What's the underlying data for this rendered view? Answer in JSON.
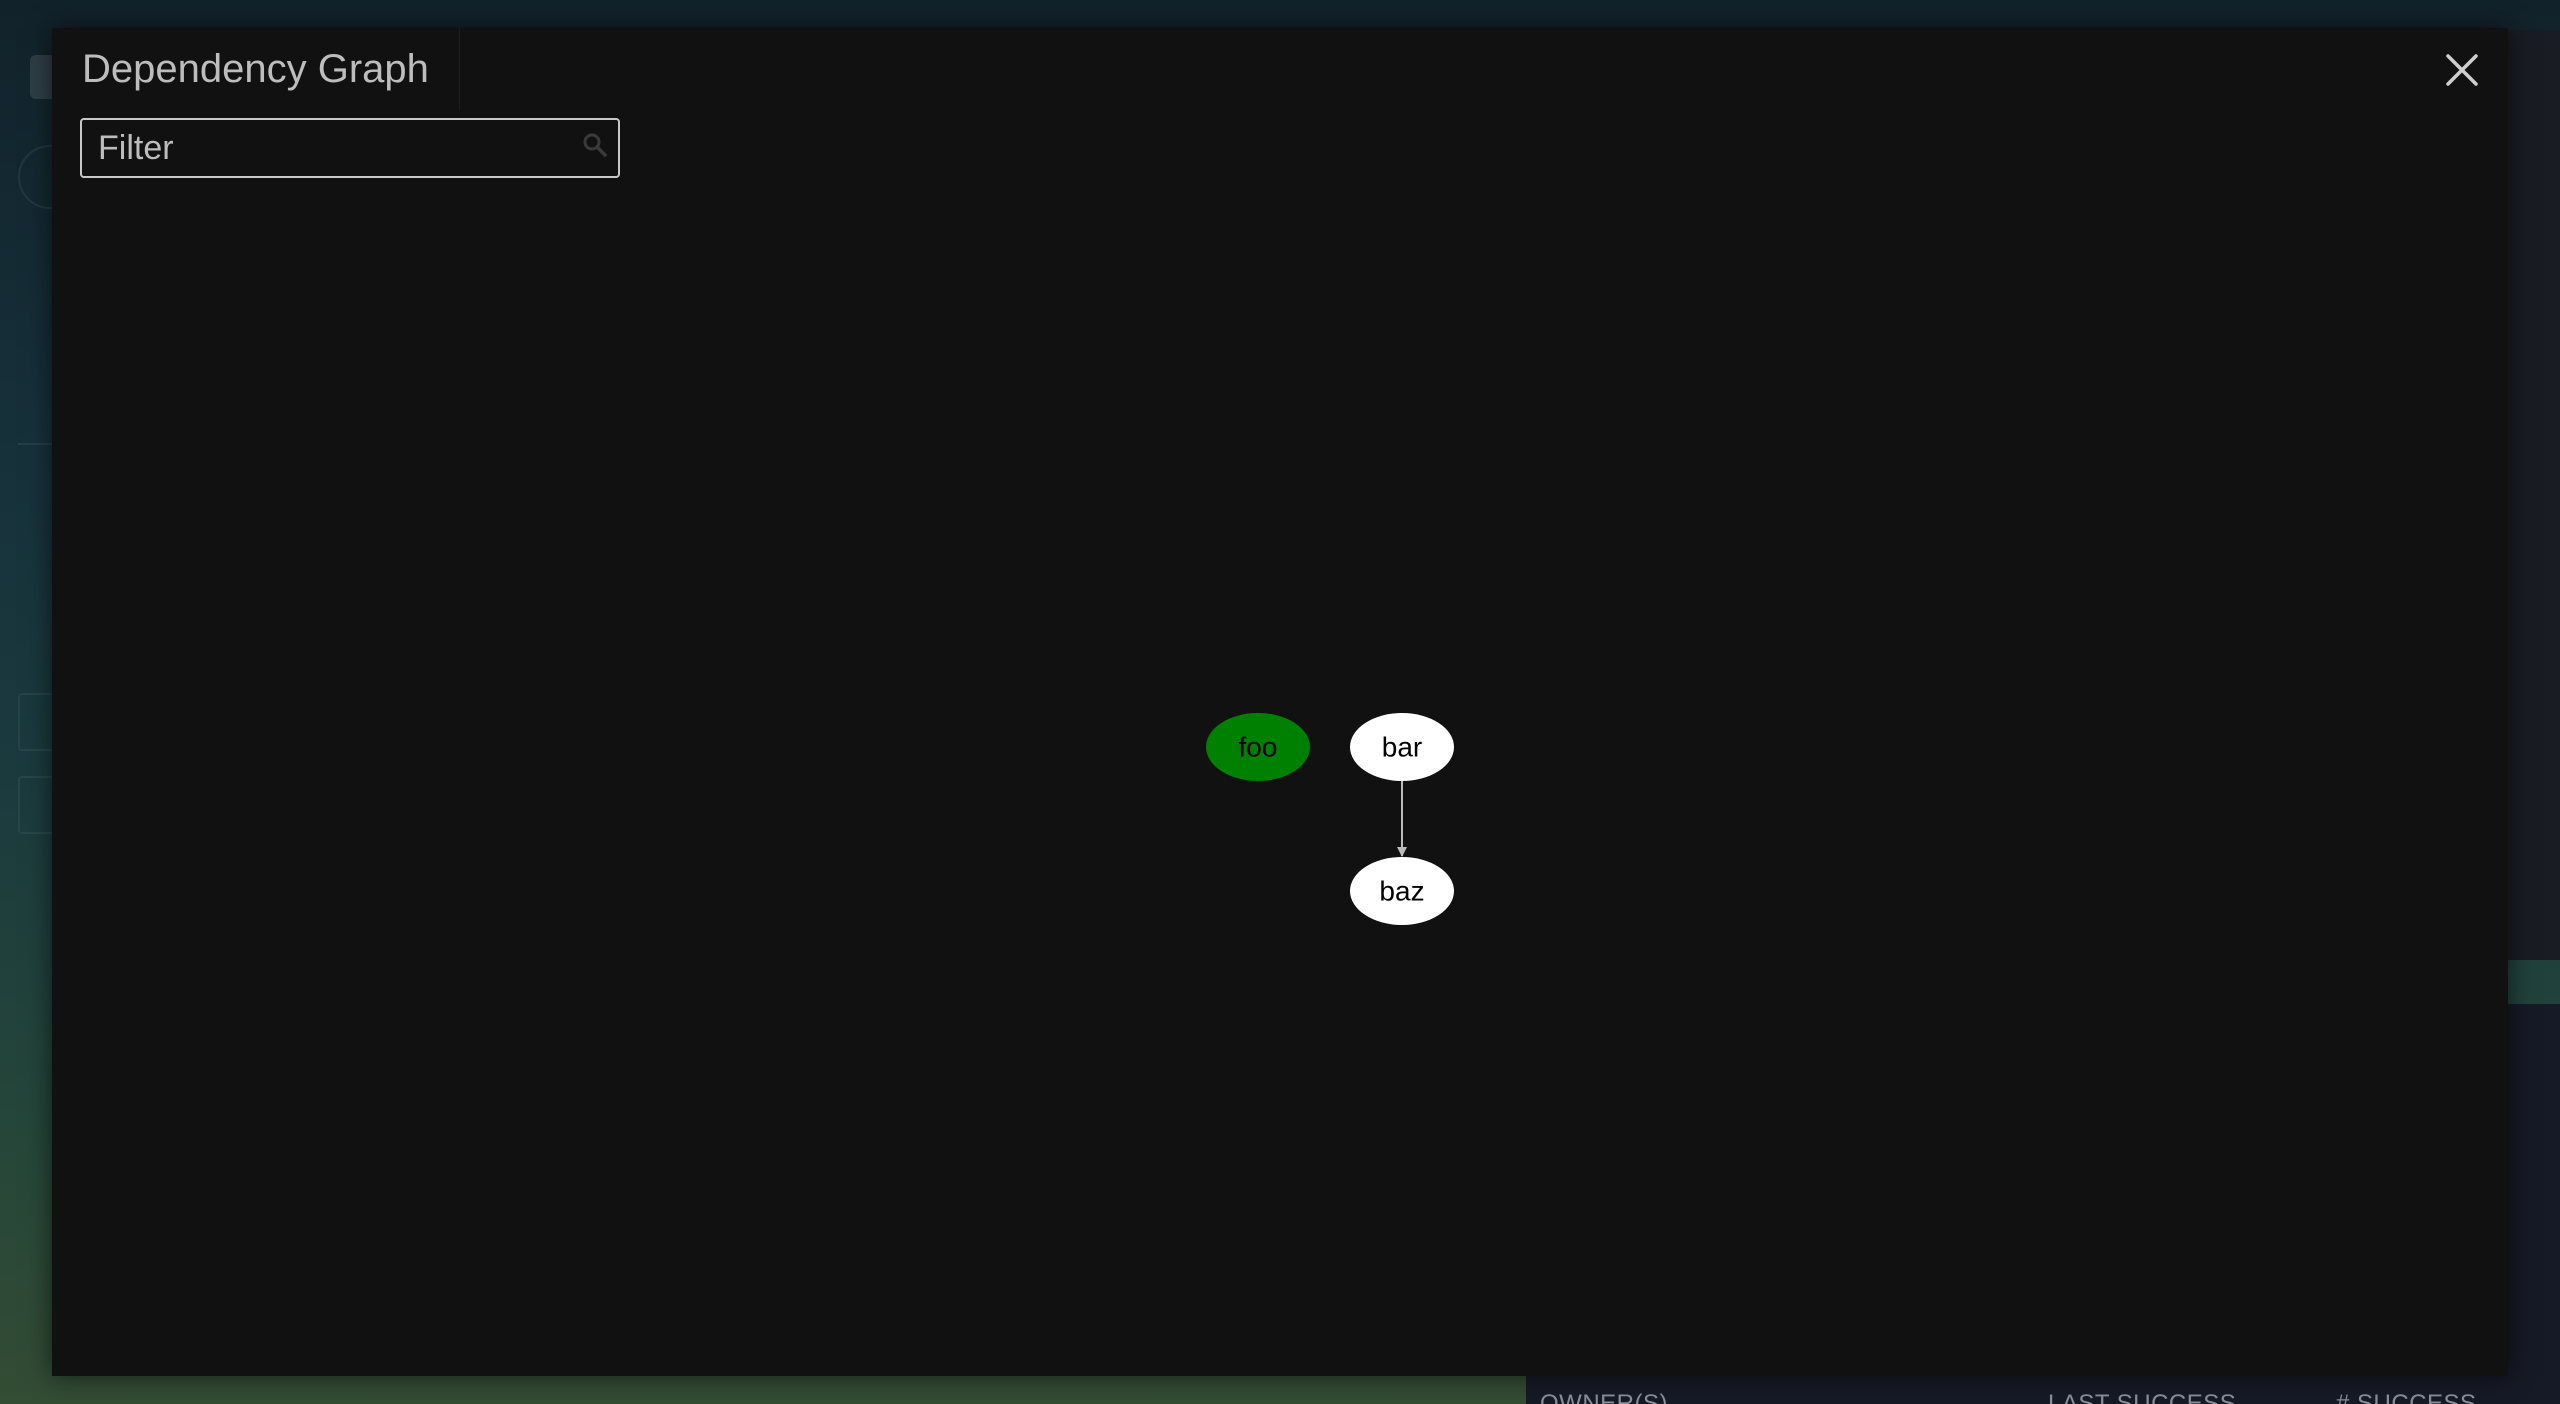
{
  "background": {
    "table_headers": [
      "OWNER(S)",
      "LAST SUCCESS",
      "# SUCCESS"
    ]
  },
  "modal": {
    "title": "Dependency Graph",
    "close_icon": "close-icon",
    "filter": {
      "placeholder": "Filter",
      "value": "",
      "icon": "search-icon"
    }
  },
  "graph": {
    "nodes": [
      {
        "id": "foo",
        "label": "foo",
        "fill": "#008000",
        "text_color": "#000000"
      },
      {
        "id": "bar",
        "label": "bar",
        "fill": "#ffffff",
        "text_color": "#000000"
      },
      {
        "id": "baz",
        "label": "baz",
        "fill": "#ffffff",
        "text_color": "#000000"
      }
    ],
    "edges": [
      {
        "from": "bar",
        "to": "baz"
      }
    ]
  },
  "colors": {
    "modal_bg": "#111111",
    "title_text": "#bdbdbd",
    "active_node": "#008000",
    "edge": "#bbbbbb"
  }
}
